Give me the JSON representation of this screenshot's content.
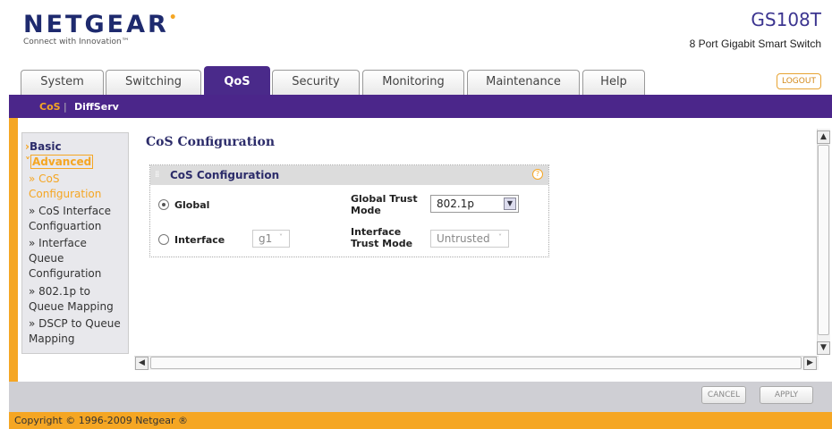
{
  "header": {
    "logo": "NETGEAR",
    "tagline": "Connect with Innovation™",
    "model": "GS108T",
    "model_desc": "8 Port Gigabit Smart Switch",
    "logout": "LOGOUT"
  },
  "tabs": [
    {
      "label": "System"
    },
    {
      "label": "Switching"
    },
    {
      "label": "QoS",
      "active": true
    },
    {
      "label": "Security"
    },
    {
      "label": "Monitoring"
    },
    {
      "label": "Maintenance"
    },
    {
      "label": "Help"
    }
  ],
  "subnav": {
    "items": [
      "CoS",
      "DiffServ"
    ],
    "separator": "|",
    "active": "CoS"
  },
  "sidebar": {
    "basic": "Basic",
    "advanced": "Advanced",
    "items": [
      {
        "label": "» CoS Configuration",
        "active": true
      },
      {
        "label": "» CoS Interface Configuartion"
      },
      {
        "label": "» Interface Queue Configuration"
      },
      {
        "label": "» 802.1p to Queue Mapping"
      },
      {
        "label": "» DSCP to Queue Mapping"
      }
    ]
  },
  "page": {
    "title": "CoS Configuration"
  },
  "panel": {
    "title": "CoS Configuration",
    "help_icon": "question-icon",
    "global": {
      "label": "Global",
      "selected": true,
      "trust_label": "Global Trust Mode",
      "trust_value": "802.1p"
    },
    "interface": {
      "label": "Interface",
      "selected": false,
      "port_value": "g1",
      "trust_label": "Interface Trust Mode",
      "trust_value": "Untrusted"
    }
  },
  "buttons": {
    "cancel": "CANCEL",
    "apply": "APPLY"
  },
  "footer": {
    "copyright": "Copyright © 1996-2009 Netgear ®"
  },
  "colors": {
    "purple": "#4b268a",
    "orange": "#f5a623",
    "navy": "#2c2c6a"
  }
}
